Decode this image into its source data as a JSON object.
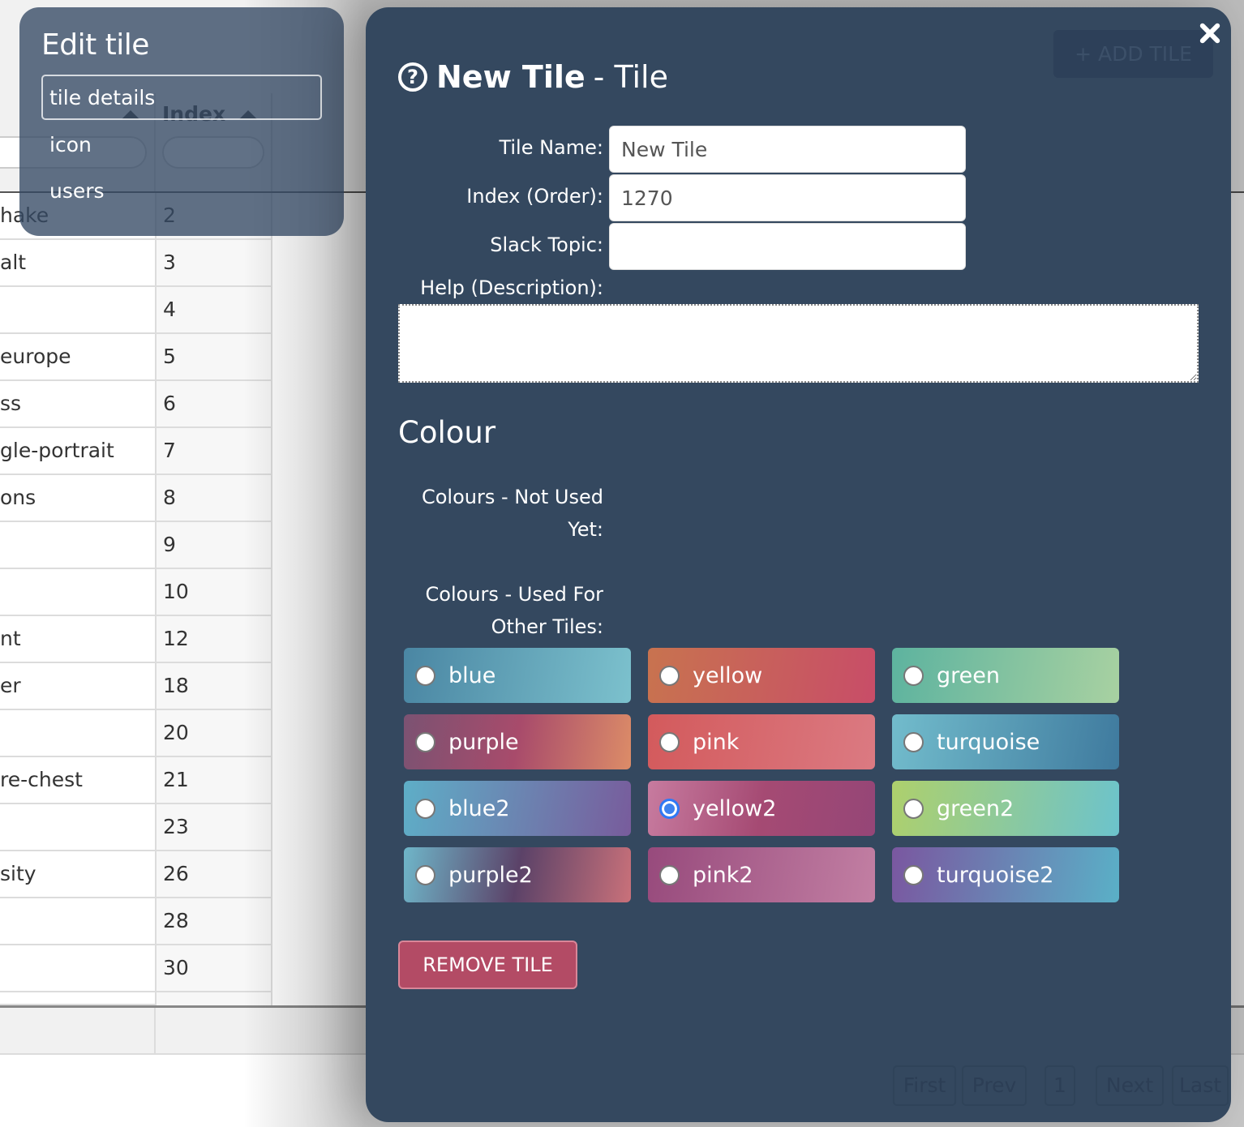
{
  "background": {
    "index_header": "Index",
    "rows": [
      {
        "name": "hake",
        "index": "2"
      },
      {
        "name": "alt",
        "index": "3"
      },
      {
        "name": "",
        "index": "4"
      },
      {
        "name": "europe",
        "index": "5"
      },
      {
        "name": "ss",
        "index": "6"
      },
      {
        "name": "gle-portrait",
        "index": "7"
      },
      {
        "name": "ons",
        "index": "8"
      },
      {
        "name": "",
        "index": "9"
      },
      {
        "name": "",
        "index": "10"
      },
      {
        "name": "nt",
        "index": "12"
      },
      {
        "name": "er",
        "index": "18"
      },
      {
        "name": "",
        "index": "20"
      },
      {
        "name": "re-chest",
        "index": "21"
      },
      {
        "name": "",
        "index": "23"
      },
      {
        "name": "sity",
        "index": "26"
      },
      {
        "name": "",
        "index": "28"
      },
      {
        "name": "",
        "index": "30"
      }
    ],
    "add_tile_label": "+ ADD TILE",
    "pager": {
      "first": "First",
      "prev": "Prev",
      "page": "1",
      "next": "Next",
      "last": "Last"
    }
  },
  "edit_menu": {
    "title": "Edit tile",
    "items": [
      {
        "label": "tile details",
        "active": true
      },
      {
        "label": "icon",
        "active": false
      },
      {
        "label": "users",
        "active": false
      }
    ]
  },
  "modal": {
    "title_name": "New Tile",
    "title_suffix": "- Tile",
    "help_icon_glyph": "?",
    "fields": {
      "tile_name_label": "Tile Name:",
      "tile_name_value": "New Tile",
      "index_label": "Index (Order):",
      "index_value": "1270",
      "slack_label": "Slack Topic:",
      "slack_value": "",
      "help_label": "Help (Description):",
      "help_value": ""
    },
    "colour": {
      "heading": "Colour",
      "not_used_label_line1": "Colours - Not Used",
      "not_used_label_line2": "Yet:",
      "used_label_line1": "Colours - Used For",
      "used_label_line2": "Other Tiles:",
      "selected": "yellow2",
      "options": [
        {
          "name": "blue",
          "gradient": [
            "#4a86a3",
            "#7cc1cd"
          ]
        },
        {
          "name": "yellow",
          "gradient": [
            "#c8734f",
            "#c84d68"
          ]
        },
        {
          "name": "green",
          "gradient": [
            "#5db39f",
            "#a8d1a1"
          ]
        },
        {
          "name": "purple",
          "gradient": [
            "#7b5272",
            "#a84b6b",
            "#dc8c68"
          ]
        },
        {
          "name": "pink",
          "gradient": [
            "#d35a5c",
            "#db7a82"
          ]
        },
        {
          "name": "turquoise",
          "gradient": [
            "#72bccc",
            "#3f7a9e"
          ]
        },
        {
          "name": "blue2",
          "gradient": [
            "#5eaec7",
            "#785c9c"
          ]
        },
        {
          "name": "yellow2",
          "gradient": [
            "#c77b9f",
            "#a54a73",
            "#954677"
          ]
        },
        {
          "name": "green2",
          "gradient": [
            "#aed06c",
            "#6cc3cc"
          ]
        },
        {
          "name": "purple2",
          "gradient": [
            "#6fb6c9",
            "#5b4268",
            "#c9717a"
          ]
        },
        {
          "name": "pink2",
          "gradient": [
            "#974a7c",
            "#c27fa3"
          ]
        },
        {
          "name": "turquoise2",
          "gradient": [
            "#7a57a0",
            "#5ab0c7"
          ]
        }
      ]
    },
    "remove_label": "REMOVE TILE"
  }
}
